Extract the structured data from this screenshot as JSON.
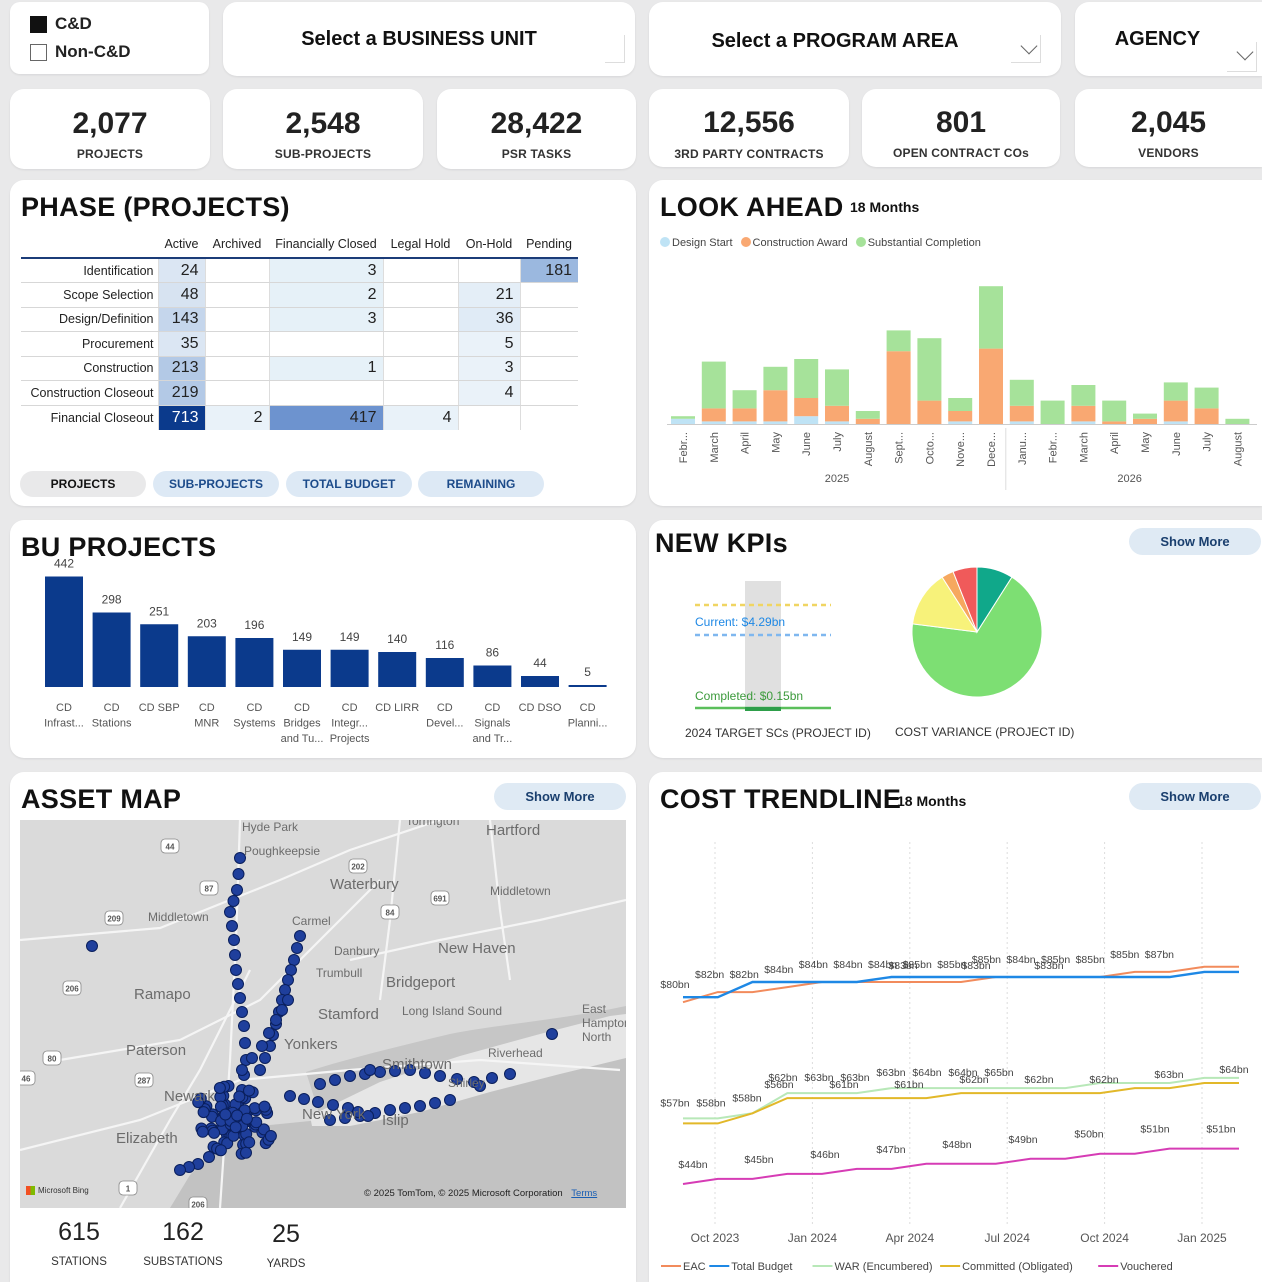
{
  "filters": {
    "cd_label": "C&D",
    "cd_checked": true,
    "non_cd_label": "Non-C&D",
    "non_cd_checked": false,
    "business_unit": "Select a BUSINESS UNIT",
    "program_area": "Select a PROGRAM AREA",
    "agency": "AGENCY"
  },
  "kpis": [
    {
      "value": "2,077",
      "label": "PROJECTS"
    },
    {
      "value": "2,548",
      "label": "SUB-PROJECTS"
    },
    {
      "value": "28,422",
      "label": "PSR TASKS"
    },
    {
      "value": "12,556",
      "label": "3RD PARTY CONTRACTS"
    },
    {
      "value": "801",
      "label": "OPEN CONTRACT COs"
    },
    {
      "value": "2,045",
      "label": "VENDORS"
    }
  ],
  "phase": {
    "title": "PHASE (PROJECTS)",
    "columns": [
      "Active",
      "Archived",
      "Financially Closed",
      "Legal Hold",
      "On-Hold",
      "Pending"
    ],
    "rows": [
      {
        "label": "Identification",
        "cells": [
          "24",
          "",
          "3",
          "",
          "",
          "181"
        ]
      },
      {
        "label": "Scope Selection",
        "cells": [
          "48",
          "",
          "2",
          "",
          "21",
          ""
        ]
      },
      {
        "label": "Design/Definition",
        "cells": [
          "143",
          "",
          "3",
          "",
          "36",
          ""
        ]
      },
      {
        "label": "Procurement",
        "cells": [
          "35",
          "",
          "",
          "",
          "5",
          ""
        ]
      },
      {
        "label": "Construction",
        "cells": [
          "213",
          "",
          "1",
          "",
          "3",
          ""
        ]
      },
      {
        "label": "Construction Closeout",
        "cells": [
          "219",
          "",
          "",
          "",
          "4",
          ""
        ]
      },
      {
        "label": "Financial Closeout",
        "cells": [
          "713",
          "2",
          "417",
          "4",
          "",
          ""
        ]
      }
    ],
    "tabs": [
      "PROJECTS",
      "SUB-PROJECTS",
      "TOTAL BUDGET",
      "REMAINING"
    ],
    "selected_tab": "PROJECTS"
  },
  "look_ahead": {
    "title": "LOOK AHEAD",
    "tag": "18 Months",
    "legend": [
      {
        "name": "Design Start",
        "color": "#bfe3f5"
      },
      {
        "name": "Construction Award",
        "color": "#f9a872"
      },
      {
        "name": "Substantial Completion",
        "color": "#a6e29a"
      }
    ],
    "years": [
      "2025",
      "2026"
    ]
  },
  "bu_projects": {
    "title": "BU PROJECTS"
  },
  "new_kpis": {
    "title": "NEW KPIs",
    "show_more": "Show More",
    "current_label": "Current: $4.29bn",
    "completed_label": "Completed: $0.15bn",
    "gauge_caption": "2024 TARGET SCs (PROJECT ID)",
    "pie_caption": "COST VARIANCE (PROJECT ID)",
    "pie_colors": [
      "#7ddf73",
      "#f7f27a",
      "#f6a85f",
      "#f05a5a",
      "#10a88a"
    ]
  },
  "asset_map": {
    "title": "ASSET MAP",
    "show_more": "Show More",
    "attribution": "© 2025 TomTom, © 2025 Microsoft Corporation",
    "terms": "Terms",
    "bing": "Microsoft Bing",
    "places": [
      "Hyde Park",
      "Poughkeepsie",
      "Torrington",
      "Hartford",
      "Waterbury",
      "Middletown",
      "Middletown",
      "Carmel",
      "Danbury",
      "New Haven",
      "Trumbull",
      "Bridgeport",
      "Ramapo",
      "Stamford",
      "Long Island Sound",
      "East Hampton North",
      "Paterson",
      "Smithtown",
      "Riverhead",
      "Shirley",
      "Newark",
      "Islip",
      "Elizabeth",
      "Yonkers",
      "New York"
    ],
    "road_shields": [
      "44",
      "202",
      "87",
      "691",
      "84",
      "209",
      "206",
      "80",
      "287",
      "1",
      "46",
      "206"
    ],
    "stats": [
      {
        "value": "615",
        "label": "STATIONS"
      },
      {
        "value": "162",
        "label": "SUBSTATIONS"
      },
      {
        "value": "25",
        "label": "YARDS"
      }
    ]
  },
  "cost_trendline": {
    "title": "COST TRENDLINE",
    "tag": "18 Months",
    "show_more": "Show More"
  },
  "chart_data": [
    {
      "type": "bar",
      "title": "LOOK AHEAD",
      "stacked": true,
      "categories": [
        "Febr...",
        "March",
        "April",
        "May",
        "June",
        "July",
        "August",
        "Sept...",
        "Octo...",
        "Nove...",
        "Dece...",
        "Janu...",
        "Febr...",
        "March",
        "April",
        "May",
        "June",
        "July",
        "August"
      ],
      "year_groups": [
        {
          "label": "2025",
          "from": 0,
          "to": 10
        },
        {
          "label": "2026",
          "from": 11,
          "to": 18
        }
      ],
      "series": [
        {
          "name": "Design Start",
          "color": "#bfe3f5",
          "values": [
            2,
            1,
            1,
            1,
            3,
            1,
            0,
            0,
            0,
            1,
            0,
            1,
            0,
            1,
            0,
            0,
            1,
            0,
            0
          ]
        },
        {
          "name": "Construction Award",
          "color": "#f9a872",
          "values": [
            0,
            5,
            5,
            12,
            7,
            6,
            2,
            28,
            9,
            4,
            29,
            6,
            0,
            6,
            1,
            2,
            8,
            6,
            0
          ]
        },
        {
          "name": "Substantial Completion",
          "color": "#a6e29a",
          "values": [
            1,
            18,
            7,
            9,
            15,
            14,
            3,
            8,
            24,
            5,
            24,
            10,
            9,
            8,
            8,
            2,
            7,
            8,
            2
          ]
        }
      ]
    },
    {
      "type": "bar",
      "title": "BU PROJECTS",
      "categories": [
        "CD Infrast...",
        "CD Stations",
        "CD SBP",
        "CD MNR",
        "CD Systems",
        "CD Bridges and Tu...",
        "CD Integr... Projects",
        "CD LIRR",
        "CD Devel...",
        "CD Signals and Tr...",
        "CD DSO",
        "CD Planni..."
      ],
      "values": [
        442,
        298,
        251,
        203,
        196,
        149,
        149,
        140,
        116,
        86,
        44,
        5
      ],
      "color": "#0b3a8c"
    },
    {
      "type": "line",
      "title": "COST TRENDLINE",
      "x": [
        "Oct 2023",
        "Jan 2024",
        "Apr 2024",
        "Jul 2024",
        "Oct 2024",
        "Jan 2025"
      ],
      "ylabel": "",
      "series": [
        {
          "name": "EAC",
          "color": "#f28b5c",
          "values": [
            80,
            82,
            82,
            83,
            84,
            84,
            84,
            84,
            84,
            85,
            85,
            85,
            85,
            86,
            86,
            87,
            87
          ]
        },
        {
          "name": "Total Budget",
          "color": "#1e88e5",
          "values": [
            81,
            81,
            84,
            84,
            84,
            84,
            85,
            85,
            85,
            85,
            85,
            85,
            85,
            85,
            85,
            86,
            86
          ]
        },
        {
          "name": "WAR (Encumbered)",
          "color": "#b8e8b8",
          "values": [
            57,
            57,
            58,
            62,
            62,
            62,
            63,
            63,
            63,
            63,
            63,
            63,
            64,
            64,
            64,
            65,
            65
          ]
        },
        {
          "name": "Committed (Obligated)",
          "color": "#e2b829",
          "values": [
            56,
            56,
            58,
            61,
            61,
            61,
            61,
            61,
            62,
            62,
            62,
            62,
            62,
            63,
            63,
            64,
            64
          ]
        },
        {
          "name": "Vouchered",
          "color": "#d63cb5",
          "values": [
            44,
            45,
            45,
            46,
            46,
            47,
            47,
            48,
            48,
            48,
            49,
            49,
            50,
            50,
            51,
            51,
            51
          ]
        }
      ],
      "labels": [
        {
          "series": "EAC",
          "points": [
            "$80bn",
            "$82bn",
            "$82bn",
            "$84bn",
            "$84bn",
            "$84bn",
            "$84bn",
            "$85bn",
            "$85bn",
            "$85bn",
            "$84bn",
            "$85bn",
            "$85bn",
            "$85bn",
            "$87bn"
          ]
        },
        {
          "series": "Total Budget",
          "points": [
            "$83bn",
            "$83bn",
            "$83bn"
          ]
        },
        {
          "series": "WAR (Encumbered)",
          "points": [
            "$57bn",
            "$58bn",
            "$58bn",
            "$62bn",
            "$63bn",
            "$63bn",
            "$63bn",
            "$64bn",
            "$64bn",
            "$65bn"
          ]
        },
        {
          "series": "Committed (Obligated)",
          "points": [
            "$56bn",
            "$61bn",
            "$61bn",
            "$62bn",
            "$62bn",
            "$62bn",
            "$63bn",
            "$64bn"
          ]
        },
        {
          "series": "Vouchered",
          "points": [
            "$44bn",
            "$45bn",
            "$46bn",
            "$47bn",
            "$48bn",
            "$49bn",
            "$50bn",
            "$51bn",
            "$51bn"
          ]
        }
      ]
    },
    {
      "type": "pie",
      "title": "COST VARIANCE (PROJECT ID)",
      "values": [
        68,
        14,
        3,
        6,
        9
      ],
      "colors": [
        "#7ddf73",
        "#f7f27a",
        "#f6a85f",
        "#f05a5a",
        "#10a88a"
      ]
    }
  ]
}
